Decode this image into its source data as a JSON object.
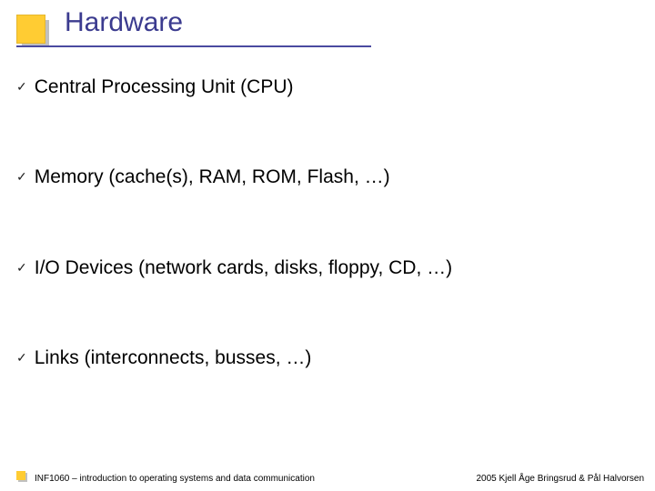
{
  "title": "Hardware",
  "bullets": {
    "b0": "Central Processing Unit (CPU)",
    "b1": "Memory (cache(s), RAM, ROM, Flash, …)",
    "b2": "I/O Devices (network cards, disks, floppy, CD, …)",
    "b3": "Links (interconnects, busses, …)"
  },
  "footer": {
    "left": "INF1060 – introduction to operating systems and data communication",
    "right": "2005 Kjell Åge Bringsrud & Pål Halvorsen"
  },
  "colors": {
    "accent_yellow": "#ffcc33",
    "title_navy": "#3b3b8f",
    "shadow_gray": "#c0c0c0"
  }
}
